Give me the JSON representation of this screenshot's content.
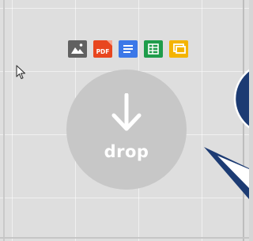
{
  "dropzone": {
    "label": "drop"
  },
  "file_types": [
    {
      "icon": "image-file-icon",
      "color": "#616161"
    },
    {
      "icon": "pdf-file-icon",
      "color": "#e8461f",
      "badge": "PDF"
    },
    {
      "icon": "document-file-icon",
      "color": "#3c78e8"
    },
    {
      "icon": "spreadsheet-file-icon",
      "color": "#1e9c4a"
    },
    {
      "icon": "presentation-file-icon",
      "color": "#f4b400"
    }
  ],
  "colors": {
    "background": "#dedede",
    "circle": "#c7c7c7",
    "callout": "#1c3b73"
  }
}
